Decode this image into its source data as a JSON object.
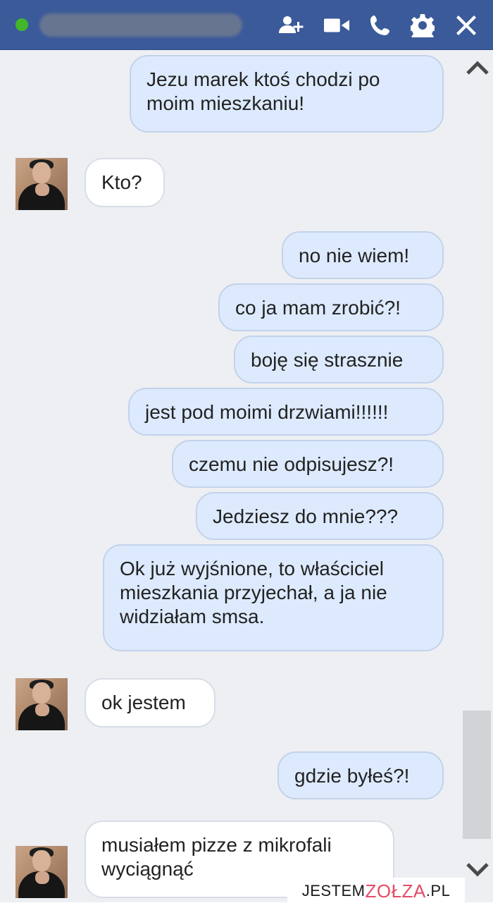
{
  "header": {
    "status": "online",
    "icons": [
      "add-people-icon",
      "video-call-icon",
      "phone-icon",
      "settings-gear-icon",
      "close-icon"
    ],
    "background": "#3b5a9a"
  },
  "messages": [
    {
      "side": "me",
      "text": "Jezu marek ktoś chodzi po moim mieszkaniu!"
    },
    {
      "side": "them",
      "text": "Kto?"
    },
    {
      "side": "me",
      "text": "no nie wiem!"
    },
    {
      "side": "me",
      "text": "co ja mam zrobić?!"
    },
    {
      "side": "me",
      "text": "boję się strasznie"
    },
    {
      "side": "me",
      "text": "jest pod moimi drzwiami!!!!!!"
    },
    {
      "side": "me",
      "text": "czemu nie odpisujesz?!"
    },
    {
      "side": "me",
      "text": "Jedziesz do mnie???"
    },
    {
      "side": "me",
      "text": "Ok już wyjśnione, to właściciel mieszkania przyjechał, a ja nie widziałam smsa."
    },
    {
      "side": "them",
      "text": "ok jestem"
    },
    {
      "side": "me",
      "text": "gdzie byłeś?!"
    },
    {
      "side": "them",
      "text": "musiałem pizze z mikrofali wyciągnąć"
    }
  ],
  "watermark": {
    "part1": "JESTEM",
    "part2": "ZOŁZA",
    "part3": ".PL"
  },
  "colors": {
    "my_bubble": "#ddeafe",
    "their_bubble": "#ffffff",
    "online": "#42b72a"
  }
}
